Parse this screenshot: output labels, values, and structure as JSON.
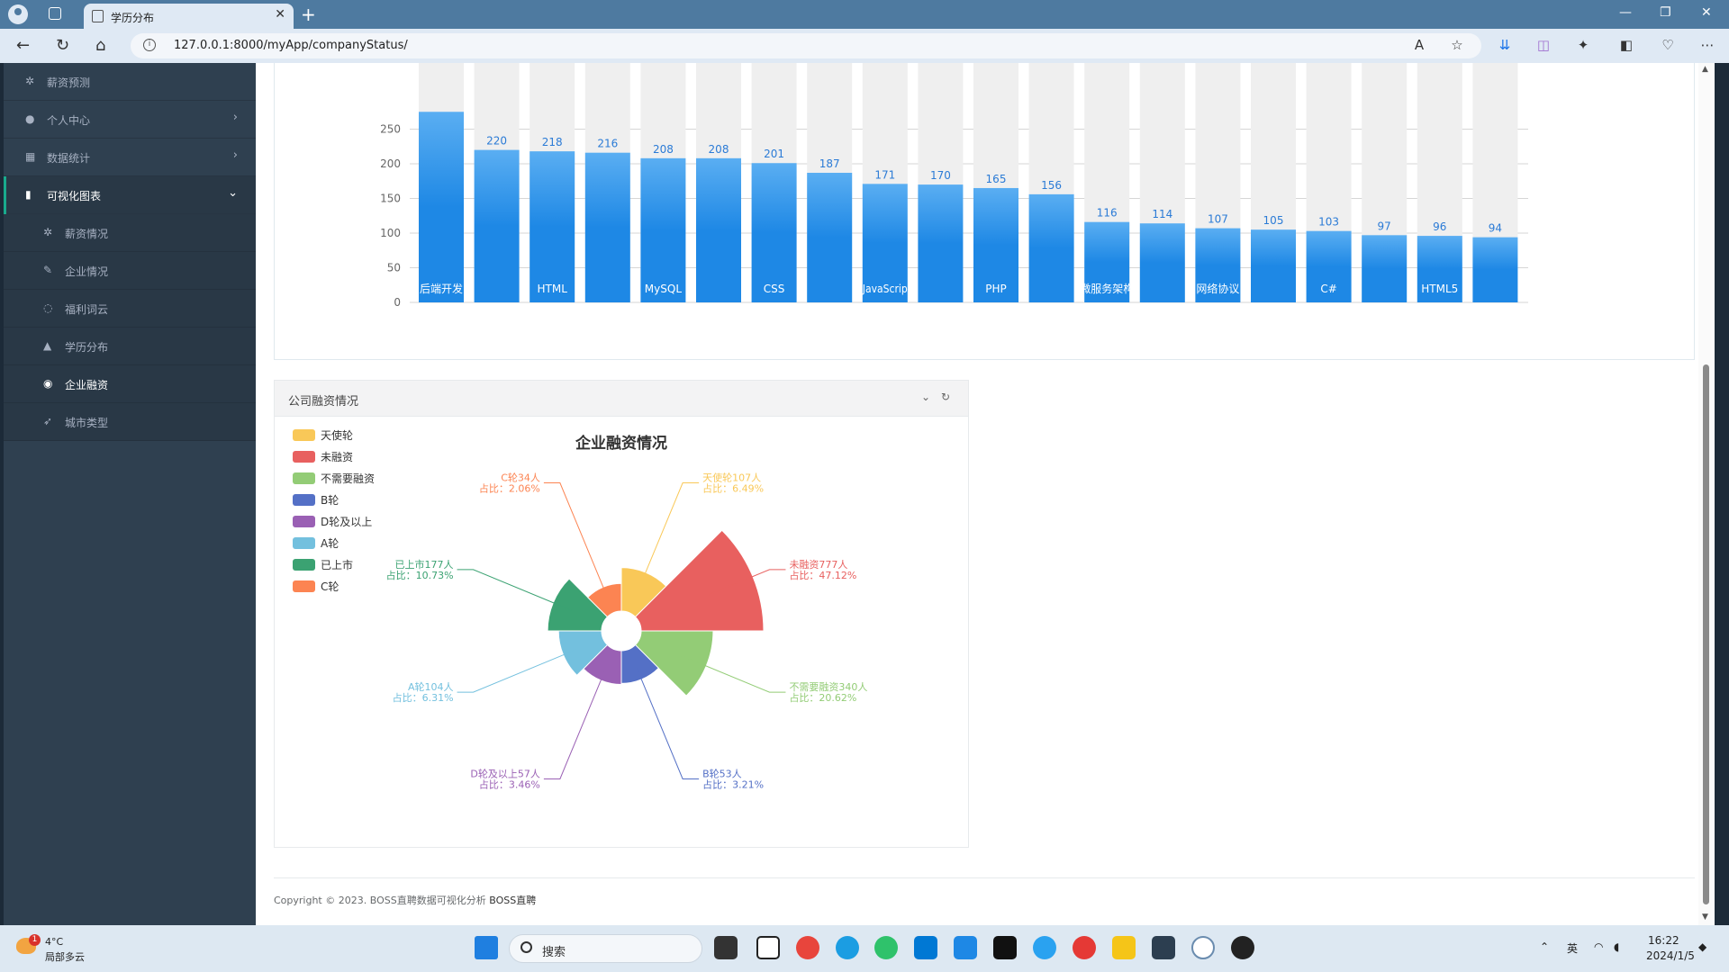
{
  "browser": {
    "tab_title": "学历分布",
    "url": "127.0.0.1:8000/myApp/companyStatus/"
  },
  "sidebar": {
    "items": [
      {
        "label": "薪资预测",
        "icon": "gear-icon"
      },
      {
        "label": "个人中心",
        "icon": "user-icon"
      },
      {
        "label": "数据统计",
        "icon": "grid-icon"
      },
      {
        "label": "可视化图表",
        "icon": "bar-chart-icon"
      }
    ],
    "subitems": [
      {
        "label": "薪资情况",
        "icon": "gear-icon"
      },
      {
        "label": "企业情况",
        "icon": "brush-icon"
      },
      {
        "label": "福利词云",
        "icon": "lightbulb-icon"
      },
      {
        "label": "学历分布",
        "icon": "graduation-cap-icon"
      },
      {
        "label": "企业融资",
        "icon": "globe-icon"
      },
      {
        "label": "城市类型",
        "icon": "rocket-icon"
      }
    ]
  },
  "bar_chart": {
    "chart_data": {
      "type": "bar",
      "ylim": [
        0,
        250
      ],
      "yticks": [
        "250",
        "200",
        "150",
        "100",
        "50",
        "0"
      ],
      "bars": [
        {
          "category": "后端开发",
          "value": 275,
          "label": ""
        },
        {
          "category": "",
          "value": 220,
          "label": "220"
        },
        {
          "category": "HTML",
          "value": 218,
          "label": "218"
        },
        {
          "category": "",
          "value": 216,
          "label": "216"
        },
        {
          "category": "MySQL",
          "value": 208,
          "label": "208"
        },
        {
          "category": "",
          "value": 208,
          "label": "208"
        },
        {
          "category": "CSS",
          "value": 201,
          "label": "201"
        },
        {
          "category": "",
          "value": 187,
          "label": "187"
        },
        {
          "category": "JavaScrip",
          "value": 171,
          "label": "171"
        },
        {
          "category": "",
          "value": 170,
          "label": "170"
        },
        {
          "category": "PHP",
          "value": 165,
          "label": "165"
        },
        {
          "category": "",
          "value": 156,
          "label": "156"
        },
        {
          "category": "微服务架构",
          "value": 116,
          "label": "116"
        },
        {
          "category": "",
          "value": 114,
          "label": "114"
        },
        {
          "category": "网络协议",
          "value": 107,
          "label": "107"
        },
        {
          "category": "",
          "value": 105,
          "label": "105"
        },
        {
          "category": "C#",
          "value": 103,
          "label": "103"
        },
        {
          "category": "",
          "value": 97,
          "label": "97"
        },
        {
          "category": "HTML5",
          "value": 96,
          "label": "96"
        },
        {
          "category": "",
          "value": 94,
          "label": "94"
        }
      ],
      "bar_color": "#1e88e5"
    }
  },
  "finance_panel": {
    "title": "公司融资情况",
    "chart_title": "企业融资情况"
  },
  "pie_chart": {
    "chart_data": {
      "type": "pie",
      "rose": true,
      "title": "企业融资情况",
      "legend_position": "top-left",
      "slices": [
        {
          "name": "天使轮",
          "value": 107,
          "pct": "6.49%",
          "color": "#f9c858",
          "label1": "天使轮107人",
          "label2": "占比：6.49%"
        },
        {
          "name": "未融资",
          "value": 777,
          "pct": "47.12%",
          "color": "#e8605f",
          "label1": "未融资777人",
          "label2": "占比：47.12%"
        },
        {
          "name": "不需要融资",
          "value": 340,
          "pct": "20.62%",
          "color": "#93cc76",
          "label1": "不需要融资340人",
          "label2": "占比：20.62%"
        },
        {
          "name": "B轮",
          "value": 53,
          "pct": "3.21%",
          "color": "#5470c6",
          "label1": "B轮53人",
          "label2": "占比：3.21%"
        },
        {
          "name": "D轮及以上",
          "value": 57,
          "pct": "3.46%",
          "color": "#9a60b4",
          "label1": "D轮及以上57人",
          "label2": "占比：3.46%"
        },
        {
          "name": "A轮",
          "value": 104,
          "pct": "6.31%",
          "color": "#73c0de",
          "label1": "A轮104人",
          "label2": "占比：6.31%"
        },
        {
          "name": "已上市",
          "value": 177,
          "pct": "10.73%",
          "color": "#3ba272",
          "label1": "已上市177人",
          "label2": "占比：10.73%"
        },
        {
          "name": "C轮",
          "value": 34,
          "pct": "2.06%",
          "color": "#fc8452",
          "label1": "C轮34人",
          "label2": "占比：2.06%"
        }
      ]
    }
  },
  "footer": {
    "text": "Copyright © 2023. BOSS直聘数据可视化分析",
    "brand": "BOSS直聘"
  },
  "taskbar": {
    "weather_temp": "4°C",
    "weather_desc": "局部多云",
    "weather_badge": "1",
    "search_label": "搜索",
    "ime": "英",
    "time": "16:22",
    "date": "2024/1/5"
  }
}
